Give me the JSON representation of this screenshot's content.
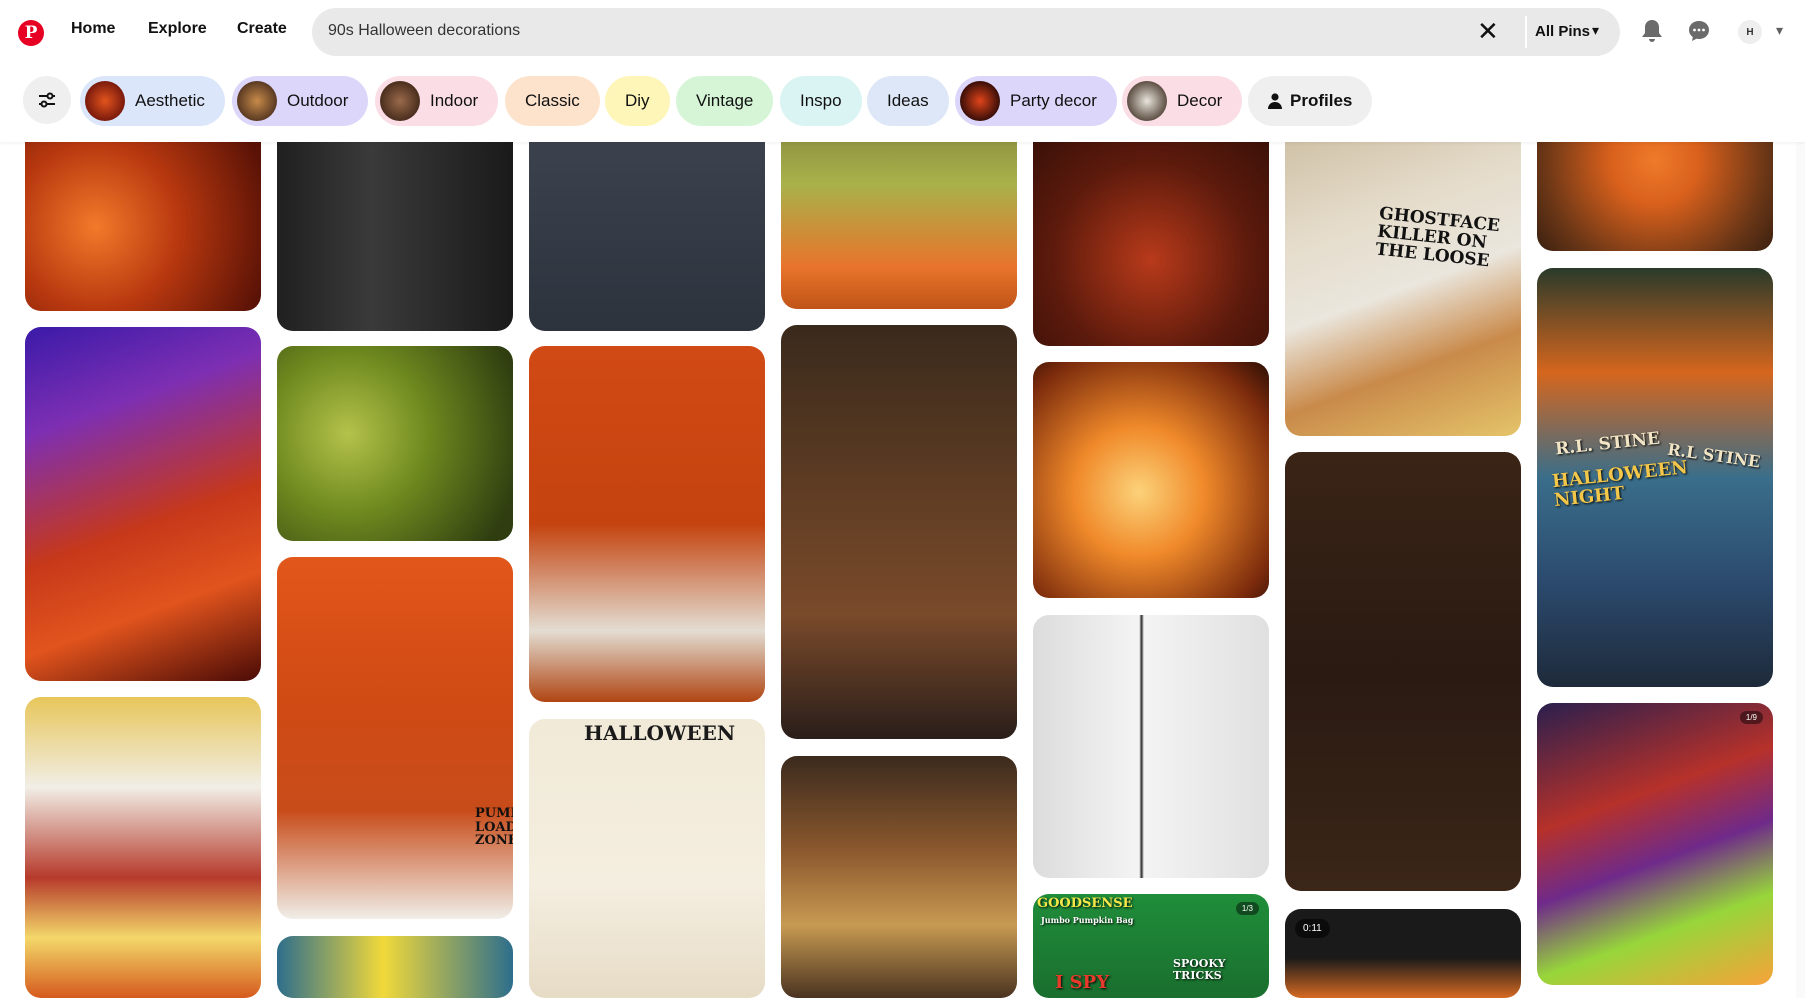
{
  "header": {
    "logo_letter": "P",
    "nav": [
      "Home",
      "Explore",
      "Create"
    ],
    "search_value": "90s Halloween decorations",
    "clear_glyph": "✕",
    "scope_label": "All Pins",
    "scope_chevron": "▾",
    "avatar_initial": "H",
    "account_chevron": "▾",
    "icons": [
      "bell-icon",
      "chat-bubble-icon"
    ]
  },
  "chips": [
    {
      "label": "Aesthetic",
      "color": "#dbe6fb"
    },
    {
      "label": "Outdoor",
      "color": "#dcd6fa"
    },
    {
      "label": "Indoor",
      "color": "#fadde5"
    },
    {
      "label": "Classic",
      "color": "#fde3cb"
    },
    {
      "label": "Diy",
      "color": "#fdf6b8"
    },
    {
      "label": "Vintage",
      "color": "#d5f5d6"
    },
    {
      "label": "Inspo",
      "color": "#d9f4f2"
    },
    {
      "label": "Ideas",
      "color": "#dde7f7"
    },
    {
      "label": "Party decor",
      "color": "#dcd6fa"
    },
    {
      "label": "Decor",
      "color": "#fadde5"
    },
    {
      "label": "Profiles",
      "color": "#efefef"
    }
  ],
  "pin_text": {
    "video_badge": "0:11",
    "page_a": "1/9",
    "page_b": "1/3",
    "ghostface": "GHOSTFACE KILLER ON THE LOOSE",
    "halloween_poster": "HALLOWEEN",
    "rl_stine_1": "R.L. STINE",
    "halloween_night": "HALLOWEEN NIGHT",
    "rl_stine_2": "R.L STINE",
    "goodsense": "GOODSENSE",
    "jumbo_bag": "Jumbo Pumpkin Bag",
    "spooky": "SPOOKY TRICKS",
    "ispy": "I SPY",
    "pump_zone": "PUMP LOAD ZONE"
  },
  "colors": {
    "brand_red": "#e60023",
    "search_bg": "#e9e9e9",
    "chip_neutral": "#efefef"
  }
}
